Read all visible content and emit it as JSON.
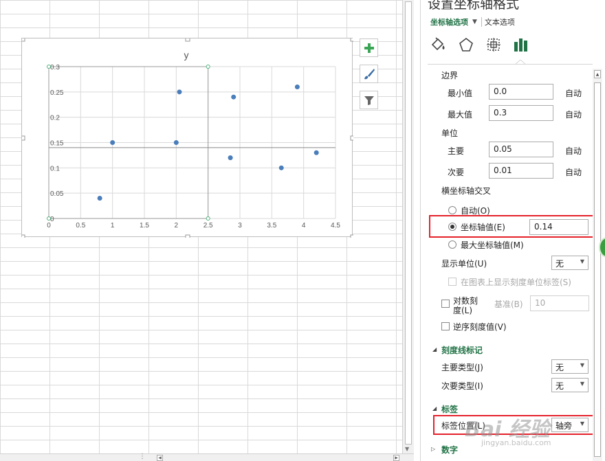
{
  "panel": {
    "title": "设置坐标轴格式",
    "tab_axis_options": "坐标轴选项",
    "tab_text_options": "文本选项",
    "bounds": {
      "header": "边界",
      "min_label": "最小值",
      "min_value": "0.0",
      "min_auto": "自动",
      "max_label": "最大值",
      "max_value": "0.3",
      "max_auto": "自动"
    },
    "units": {
      "header": "单位",
      "major_label": "主要",
      "major_value": "0.05",
      "major_auto": "自动",
      "minor_label": "次要",
      "minor_value": "0.01",
      "minor_auto": "自动"
    },
    "crosses": {
      "header": "横坐标轴交叉",
      "auto_label": "自动(O)",
      "axis_value_label": "坐标轴值(E)",
      "axis_value": "0.14",
      "max_axis_label": "最大坐标轴值(M)",
      "selected": "axis_value"
    },
    "display_units": {
      "label": "显示单位(U)",
      "value": "无",
      "show_label_text": "在图表上显示刻度单位标签(S)"
    },
    "log_scale": {
      "label_line1": "对数刻",
      "label_line2": "度(L)",
      "base_label": "基准(B)",
      "base_value": "10"
    },
    "reverse": {
      "label": "逆序刻度值(V)"
    },
    "tick_marks": {
      "header": "刻度线标记",
      "major_label": "主要类型(J)",
      "major_value": "无",
      "minor_label": "次要类型(I)",
      "minor_value": "无"
    },
    "labels": {
      "header": "标签",
      "position_label": "标签位置(L)",
      "position_value": "轴旁"
    },
    "number": {
      "header": "数字"
    }
  },
  "watermark": {
    "text": "Bai 经验",
    "url": "jingyan.baidu.com"
  },
  "chart_data": {
    "type": "scatter",
    "title": "y",
    "xlabel": "",
    "ylabel": "",
    "xlim": [
      0,
      4.5
    ],
    "ylim": [
      0,
      0.3
    ],
    "x_ticks": [
      "0",
      "0.5",
      "1",
      "1.5",
      "2",
      "2.5",
      "3",
      "3.5",
      "4",
      "4.5"
    ],
    "y_ticks": [
      "0",
      "0.05",
      "0.1",
      "0.15",
      "0.2",
      "0.25",
      "0.3"
    ],
    "horizontal_axis_crosses_at": 0.14,
    "grid": true,
    "series": [
      {
        "color": "#4a7ebb",
        "points": [
          {
            "x": 0.8,
            "y": 0.04
          },
          {
            "x": 1.0,
            "y": 0.15
          },
          {
            "x": 2.0,
            "y": 0.15
          },
          {
            "x": 2.05,
            "y": 0.25
          },
          {
            "x": 2.85,
            "y": 0.12
          },
          {
            "x": 2.9,
            "y": 0.24
          },
          {
            "x": 3.65,
            "y": 0.1
          },
          {
            "x": 3.9,
            "y": 0.26
          },
          {
            "x": 4.2,
            "y": 0.13
          }
        ]
      }
    ]
  }
}
